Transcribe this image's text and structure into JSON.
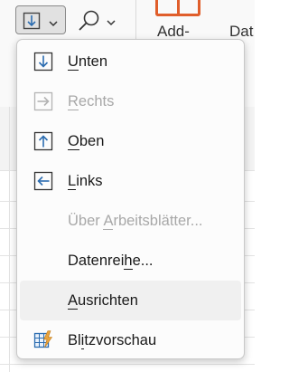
{
  "ribbon": {
    "fill_icon": "fill-down-icon",
    "find_icon": "search-icon",
    "addin_label": "Add-",
    "dat_label": "Dat"
  },
  "menu": {
    "items": [
      {
        "label": "Unten",
        "ak_index": 0,
        "icon": "arrow-down-box-icon",
        "enabled": true
      },
      {
        "label": "Rechts",
        "ak_index": 0,
        "icon": "arrow-right-box-icon",
        "enabled": false
      },
      {
        "label": "Oben",
        "ak_index": 0,
        "icon": "arrow-up-box-icon",
        "enabled": true
      },
      {
        "label": "Links",
        "ak_index": 0,
        "icon": "arrow-left-box-icon",
        "enabled": true
      },
      {
        "label": "Über Arbeitsblätter...",
        "ak_index": 5,
        "icon": "",
        "enabled": false
      },
      {
        "label": "Datenreihe...",
        "ak_index": 8,
        "icon": "",
        "enabled": true
      },
      {
        "label": "Ausrichten",
        "ak_index": 0,
        "icon": "",
        "enabled": true,
        "hover": true
      },
      {
        "label": "Blitzvorschau",
        "ak_index": 2,
        "icon": "flash-fill-icon",
        "enabled": true
      }
    ]
  },
  "colors": {
    "accent_blue": "#2b6cb0",
    "flash_orange": "#e8a33d",
    "addin_orange": "#e05e2b",
    "disabled_text": "#a8a8a8"
  }
}
